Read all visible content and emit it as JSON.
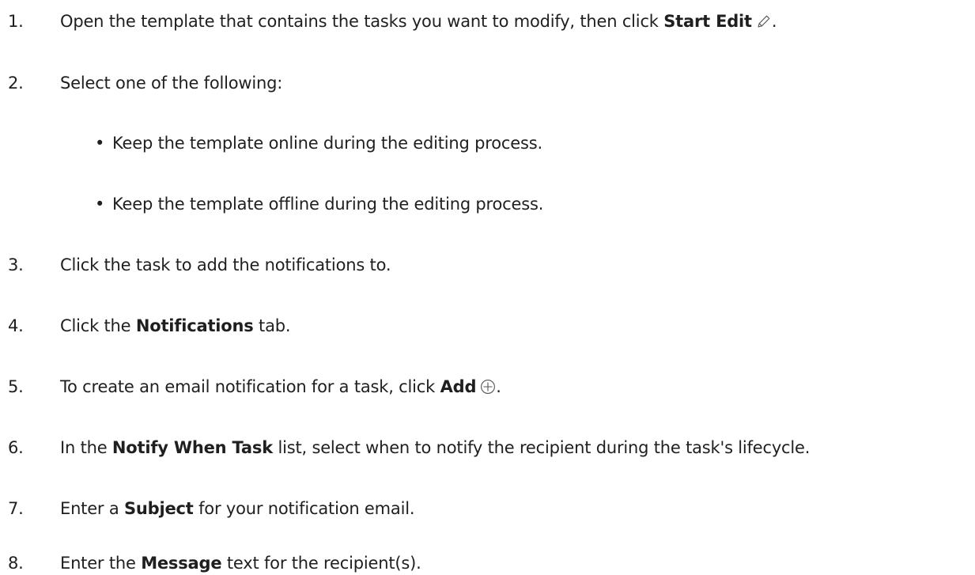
{
  "steps": [
    {
      "number": "1.",
      "before": "Open the template that contains the tasks you want to modify, then click ",
      "bold": "Start Edit",
      "after": ".",
      "icon": "pencil-icon"
    },
    {
      "number": "2.",
      "text": "Select one of the following:",
      "bullets": [
        "Keep the template online during the editing process.",
        "Keep the template offline during the editing process."
      ]
    },
    {
      "number": "3.",
      "text": "Click the task to add the notifications to."
    },
    {
      "number": "4.",
      "before": "Click the ",
      "bold": "Notifications",
      "after": " tab."
    },
    {
      "number": "5.",
      "before": "To create an email notification for a task, click ",
      "bold": "Add",
      "after": ".",
      "icon": "add-circle-icon"
    },
    {
      "number": "6.",
      "before": "In the ",
      "bold": "Notify When Task",
      "after": " list, select when to notify the recipient during the task's lifecycle."
    },
    {
      "number": "7.",
      "before": "Enter a ",
      "bold": "Subject",
      "after": " for your notification email."
    },
    {
      "number": "8.",
      "before": "Enter the ",
      "bold": "Message",
      "after": " text for the recipient(s)."
    }
  ],
  "bullet_glyph": "•",
  "colors": {
    "text": "#1f1f1f",
    "background": "#ffffff"
  }
}
